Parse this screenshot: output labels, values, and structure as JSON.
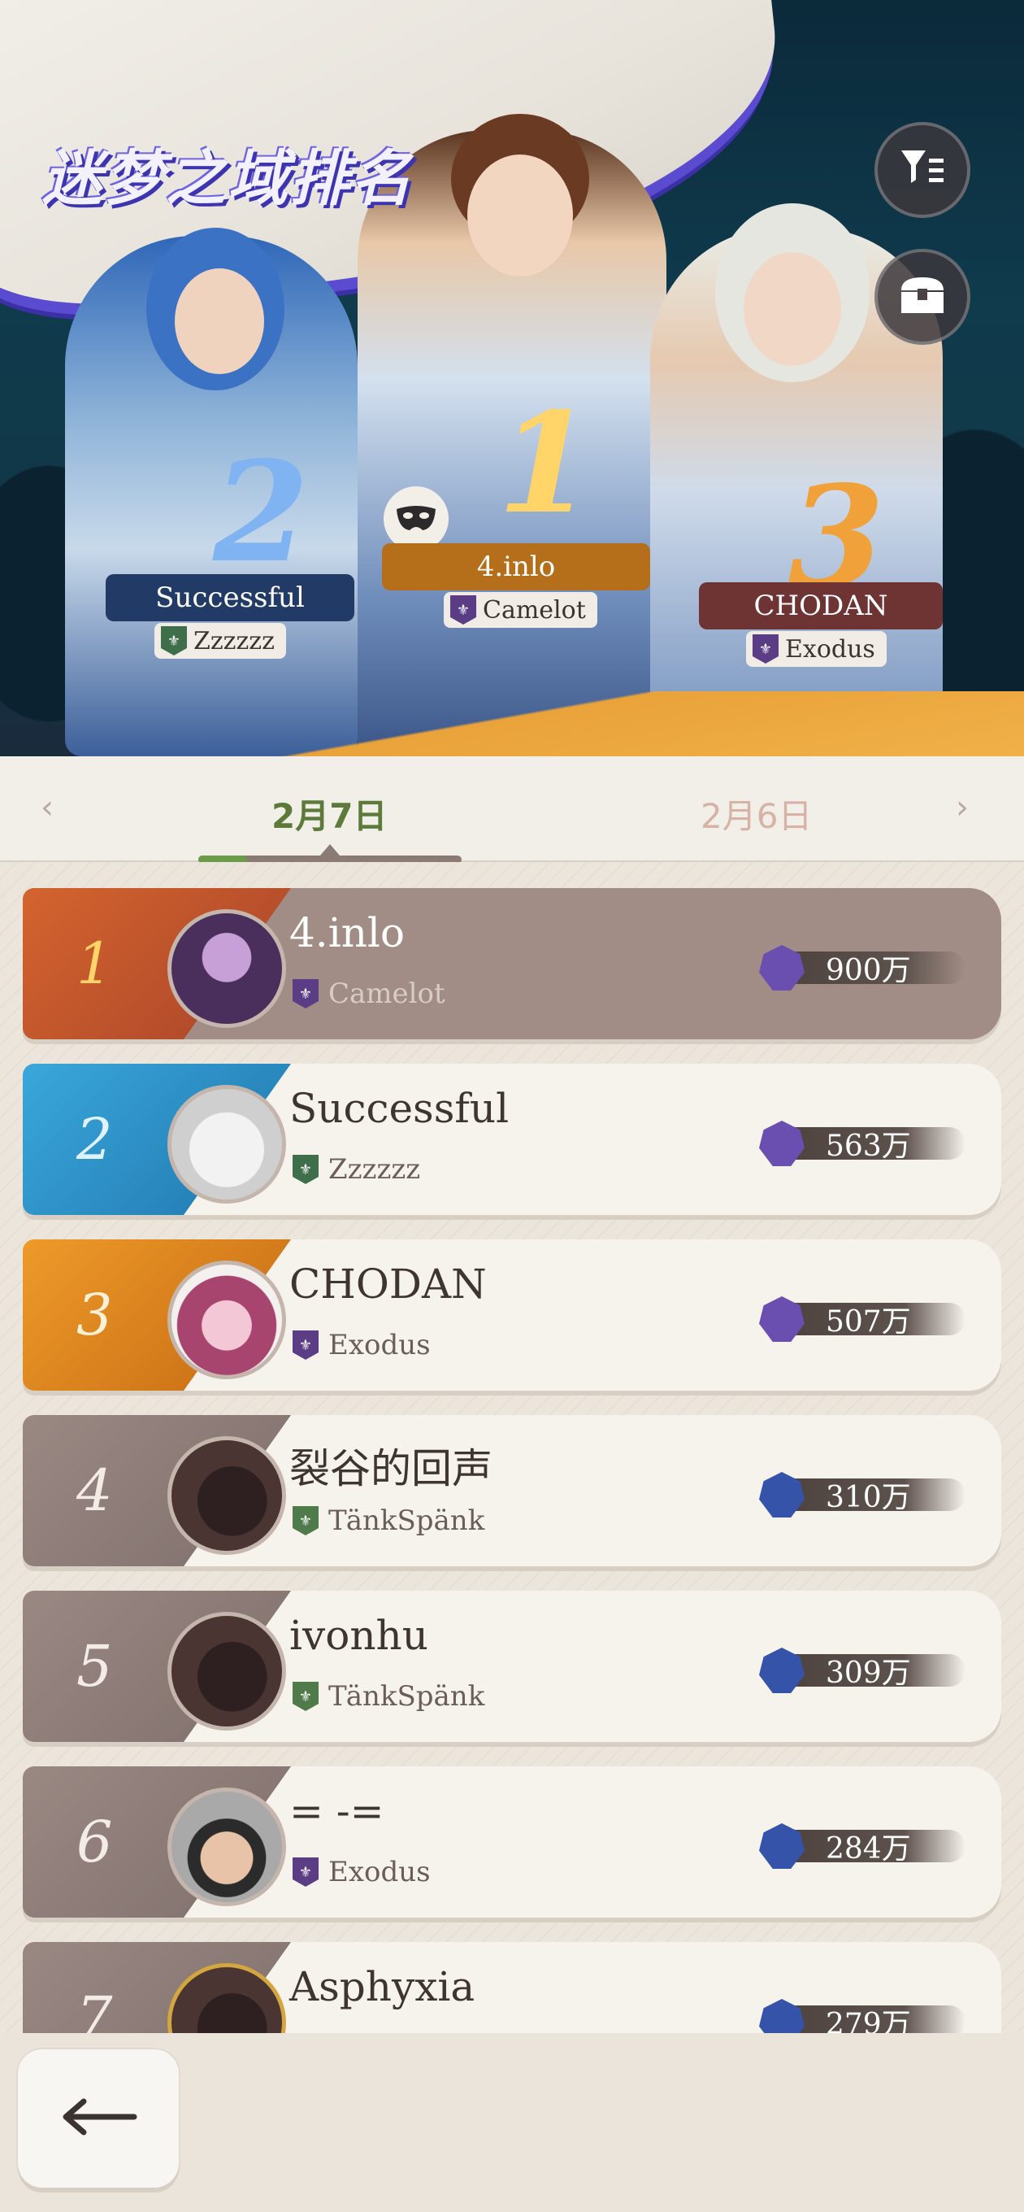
{
  "header": {
    "title": "迷梦之域排名",
    "filter_icon": "filter-list-icon",
    "reward_icon": "treasure-chest-icon"
  },
  "podium": [
    {
      "rank": "2",
      "name": "Successful",
      "guild": "Zzzzzz",
      "color": "#2a4f80"
    },
    {
      "rank": "1",
      "name": "4.inlo",
      "guild": "Camelot",
      "color": "#c07a20"
    },
    {
      "rank": "3",
      "name": "CHODAN",
      "guild": "Exodus",
      "color": "#7a3a3a"
    }
  ],
  "tabs": {
    "active": "2月7日",
    "inactive": "2月6日",
    "prev_icon": "chevron-left-icon",
    "next_icon": "chevron-right-icon"
  },
  "rows": [
    {
      "rank": "1",
      "name": "4.inlo",
      "guild": "Camelot",
      "score": "900万",
      "accent": "#c4582a",
      "guild_color": "#5b3d86"
    },
    {
      "rank": "2",
      "name": "Successful",
      "guild": "Zzzzzz",
      "score": "563万",
      "accent": "#2f8ec4",
      "guild_color": "#3f6e4a"
    },
    {
      "rank": "3",
      "name": "CHODAN",
      "guild": "Exodus",
      "score": "507万",
      "accent": "#e08a1e",
      "guild_color": "#5b3d86"
    },
    {
      "rank": "4",
      "name": "裂谷的回声",
      "guild": "TänkSpänk",
      "score": "310万",
      "accent": "#8e7d78",
      "guild_color": "#4f7a4a"
    },
    {
      "rank": "5",
      "name": "ivonhu",
      "guild": "TänkSpänk",
      "score": "309万",
      "accent": "#8e7d78",
      "guild_color": "#4f7a4a"
    },
    {
      "rank": "6",
      "name": "= -=",
      "guild": "Exodus",
      "score": "284万",
      "accent": "#8e7d78",
      "guild_color": "#5b3d86"
    },
    {
      "rank": "7",
      "name": "Asphyxia",
      "guild": "",
      "score": "279万",
      "accent": "#8e7d78",
      "guild_color": "#5b3d86"
    }
  ],
  "back_button": {
    "icon": "back-arrow-icon"
  }
}
